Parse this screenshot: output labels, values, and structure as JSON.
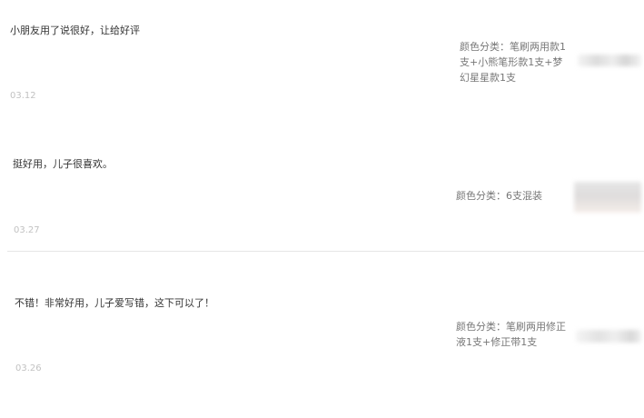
{
  "reviews": [
    {
      "text": "小朋友用了说很好，让给好评",
      "date": "03.12",
      "sku_label": "颜色分类：",
      "sku_value": "笔刷两用款1支+小熊笔形款1支+梦幻星星款1支"
    },
    {
      "text": "挺好用，儿子很喜欢。",
      "date": "03.27",
      "sku_label": "颜色分类：",
      "sku_value": "6支混装"
    },
    {
      "text": "不错！非常好用，儿子爱写错，这下可以了！",
      "date": "03.26",
      "sku_label": "颜色分类：",
      "sku_value": "笔刷两用修正液1支+修正带1支"
    }
  ]
}
